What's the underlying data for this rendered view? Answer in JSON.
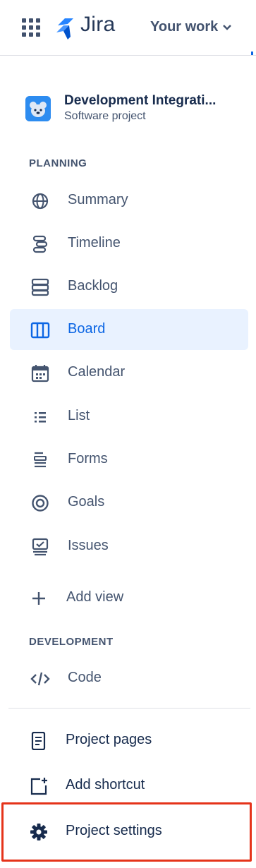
{
  "topbar": {
    "brand": "Jira",
    "your_work": "Your work"
  },
  "project": {
    "name": "Development Integrati...",
    "type": "Software project"
  },
  "sections": {
    "planning": "PLANNING",
    "development": "DEVELOPMENT"
  },
  "planning_items": [
    {
      "label": "Summary",
      "icon": "globe-icon"
    },
    {
      "label": "Timeline",
      "icon": "timeline-icon"
    },
    {
      "label": "Backlog",
      "icon": "backlog-icon"
    },
    {
      "label": "Board",
      "icon": "board-icon",
      "selected": true
    },
    {
      "label": "Calendar",
      "icon": "calendar-icon"
    },
    {
      "label": "List",
      "icon": "list-icon"
    },
    {
      "label": "Forms",
      "icon": "forms-icon"
    },
    {
      "label": "Goals",
      "icon": "goals-icon"
    },
    {
      "label": "Issues",
      "icon": "issues-icon"
    }
  ],
  "add_view": "Add view",
  "development_items": [
    {
      "label": "Code",
      "icon": "code-icon"
    }
  ],
  "bottom_items": [
    {
      "label": "Project pages",
      "icon": "page-icon"
    },
    {
      "label": "Add shortcut",
      "icon": "add-shortcut-icon"
    },
    {
      "label": "Project settings",
      "icon": "gear-icon"
    }
  ],
  "colors": {
    "accent": "#0c66e4",
    "selected_bg": "#e9f2ff",
    "highlight": "#e5331a"
  }
}
